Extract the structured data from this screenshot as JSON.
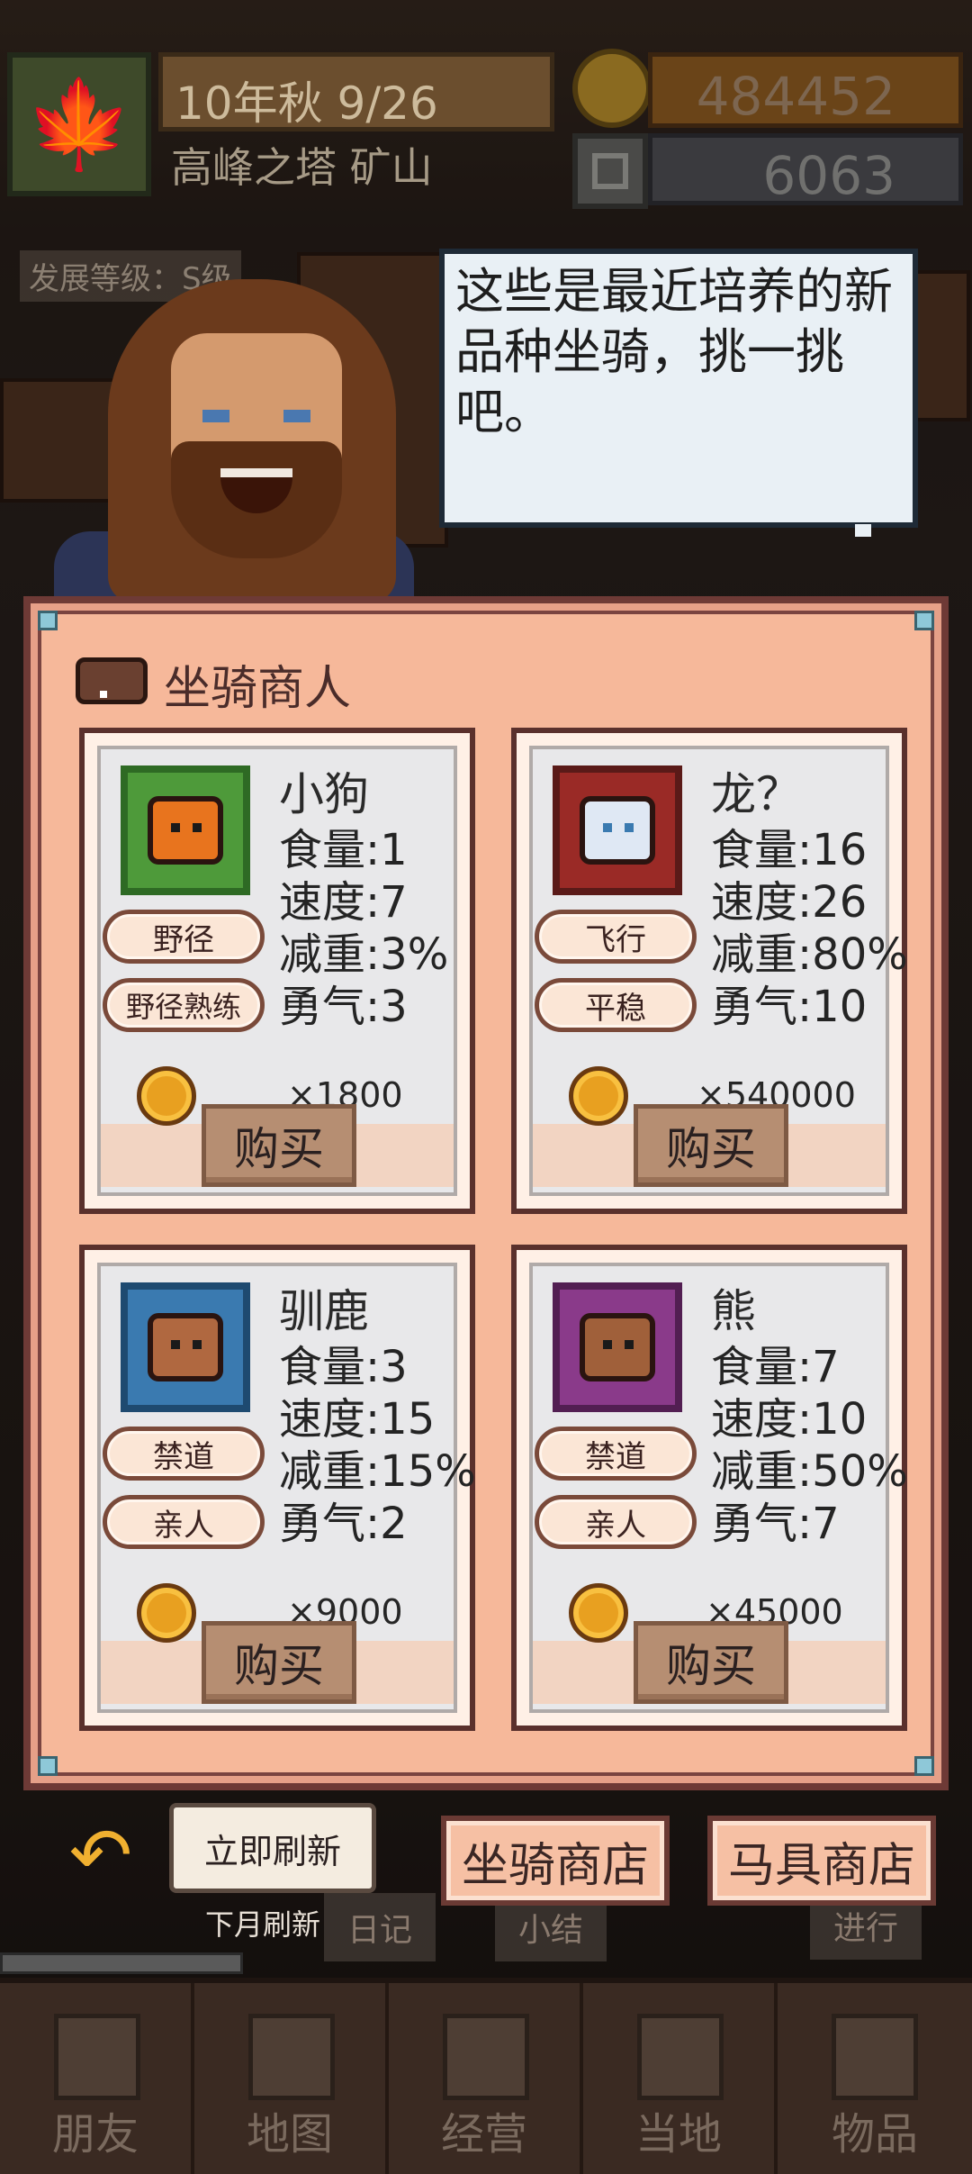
{
  "top_bar": {
    "season_icon": "maple-leaf-icon",
    "date": "10年秋 9/26",
    "location": "高峰之塔 矿山",
    "gold": "484452",
    "gems": "6063",
    "dev_level": "发展等级：S级"
  },
  "speech": {
    "text": "这些是最近培养的新品种坐骑，挑一挑吧。"
  },
  "shop": {
    "title": "坐骑商人",
    "title_icon": "boar-icon",
    "cards": [
      {
        "name": "小狗",
        "food": "食量:1",
        "speed": "速度:7",
        "weight": "减重:3%",
        "courage": "勇气:3",
        "traits": [
          "野径",
          "野径熟练"
        ],
        "price": "×1800",
        "buy": "购买",
        "frame_color": "#4e9a3a",
        "creature_color": "#e8741e"
      },
      {
        "name": "龙？",
        "food": "食量:16",
        "speed": "速度:26",
        "weight": "减重:80%",
        "courage": "勇气:10",
        "traits": [
          "飞行",
          "平稳"
        ],
        "price": "×540000",
        "buy": "购买",
        "frame_color": "#9a2a26",
        "creature_color": "#dfe8f4"
      },
      {
        "name": "驯鹿",
        "food": "食量:3",
        "speed": "速度:15",
        "weight": "减重:15%",
        "courage": "勇气:2",
        "traits": [
          "禁道",
          "亲人"
        ],
        "price": "×9000",
        "buy": "购买",
        "frame_color": "#3a7ab0",
        "creature_color": "#b06840"
      },
      {
        "name": "熊",
        "food": "食量:7",
        "speed": "速度:10",
        "weight": "减重:50%",
        "courage": "勇气:7",
        "traits": [
          "禁道",
          "亲人"
        ],
        "price": "×45000",
        "buy": "购买",
        "frame_color": "#8a3a8a",
        "creature_color": "#a0603a"
      }
    ]
  },
  "controls": {
    "refresh_now": "立即刷新",
    "refresh_note": "下月刷新",
    "mount_shop": "坐骑商店",
    "tack_shop": "马具商店",
    "diary": "日记",
    "summary": "小结",
    "proceed": "进行"
  },
  "nav": [
    "朋友",
    "地图",
    "经营",
    "当地",
    "物品"
  ]
}
